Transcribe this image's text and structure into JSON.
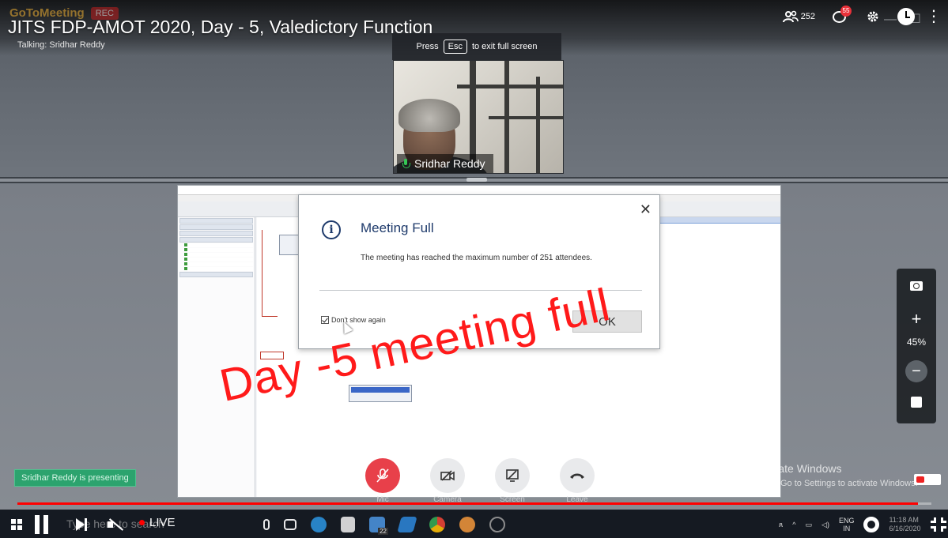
{
  "video": {
    "title": "JITS FDP-AMOT 2020, Day - 5, Valedictory Function",
    "live_label": "LIVE",
    "progress_fraction": 0.985
  },
  "gotomeeting": {
    "logo_text": "GoToMeeting",
    "rec_label": "REC",
    "talking": "Talking: Sridhar Reddy",
    "attendee_count": "252",
    "chat_unread": "55",
    "presenter_name": "Sridhar Reddy",
    "presenting_status": "Sridhar Reddy is presenting",
    "zoom_level": "45%",
    "controls": [
      {
        "label": "Mic"
      },
      {
        "label": "Camera"
      },
      {
        "label": "Screen"
      },
      {
        "label": "Leave"
      }
    ]
  },
  "fullscreen_hint": {
    "before": "Press",
    "key": "Esc",
    "after": "to exit full screen"
  },
  "dialog": {
    "title": "Meeting Full",
    "message": "The meeting has reached the maximum number of 251 attendees.",
    "checkbox_label": "Don't show again",
    "ok_label": "OK"
  },
  "overlay": {
    "text": "Day -5 meeting full",
    "color": "#ff1a1a"
  },
  "windows": {
    "activate_title": "Activate Windows",
    "activate_sub": "Go to Settings to activate Windows.",
    "search_placeholder": "Type here to search",
    "files_badge": "22",
    "lang_top": "ENG",
    "lang_bottom": "IN",
    "time": "11:18 AM",
    "date": "6/16/2020"
  },
  "colors": {
    "accent_red": "#e8404a",
    "progress_red": "#ff0000",
    "presenting_green": "#2ca36e",
    "dialog_title_blue": "#1e3a6b"
  }
}
